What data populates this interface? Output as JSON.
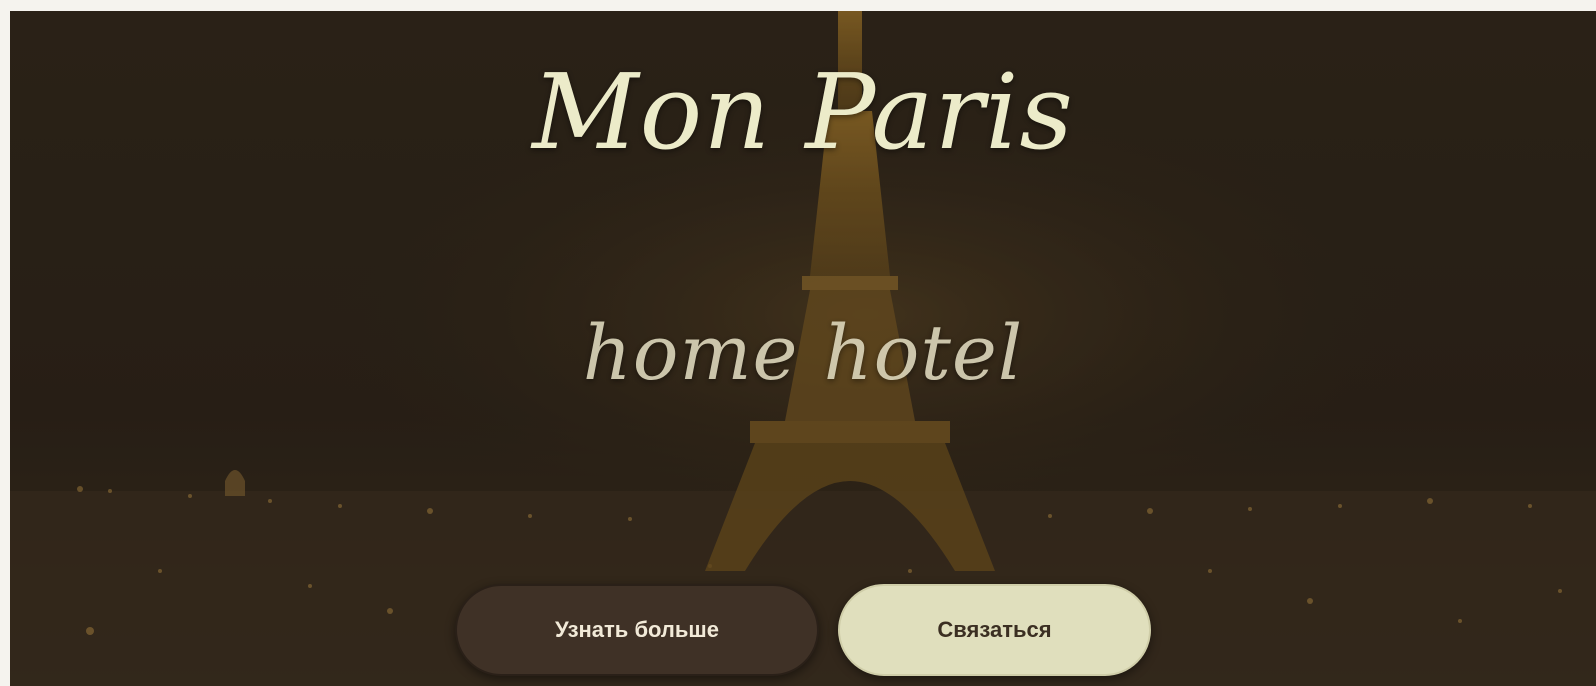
{
  "hero": {
    "title": "Mon Paris",
    "subtitle": "home hotel",
    "background_image": "paris-night-eiffel-tower"
  },
  "buttons": {
    "learn_more_label": "Узнать больше",
    "contact_label": "Связаться"
  },
  "colors": {
    "background_overlay": "#2c2319",
    "title_text": "#ecebc9",
    "button_dark": "#3f3126",
    "button_light": "#e0dfbd"
  }
}
